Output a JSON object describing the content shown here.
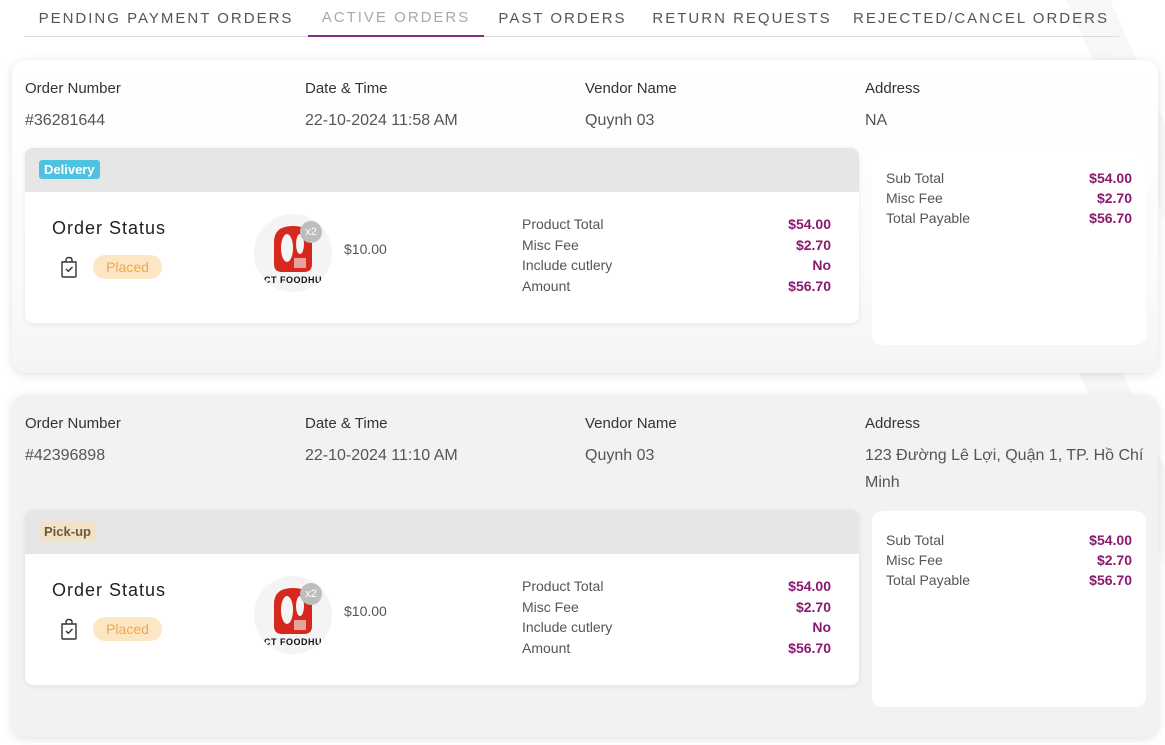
{
  "tabs": [
    {
      "label": "PENDING PAYMENT ORDERS"
    },
    {
      "label": "ACTIVE ORDERS"
    },
    {
      "label": "PAST ORDERS"
    },
    {
      "label": "RETURN REQUESTS"
    },
    {
      "label": "REJECTED/CANCEL ORDERS"
    }
  ],
  "labels": {
    "order_number": "Order Number",
    "date_time": "Date & Time",
    "vendor_name": "Vendor Name",
    "address": "Address",
    "order_status": "Order Status",
    "product_total": "Product Total",
    "misc_fee": "Misc Fee",
    "include_cutlery": "Include cutlery",
    "amount": "Amount",
    "sub_total": "Sub Total",
    "total_payable": "Total Payable"
  },
  "orders": [
    {
      "order_number": "#36281644",
      "date_time": "22-10-2024 11:58 AM",
      "vendor": "Quynh 03",
      "address": "NA",
      "type": "Delivery",
      "status": "Placed",
      "item_qty": "x2",
      "item_price": "$10.00",
      "item_logo_text": "CT FOODHU",
      "product_total": "$54.00",
      "misc_fee": "$2.70",
      "cutlery": "No",
      "amount": "$56.70",
      "sub_total": "$54.00",
      "total_payable": "$56.70"
    },
    {
      "order_number": "#42396898",
      "date_time": "22-10-2024 11:10 AM",
      "vendor": "Quynh 03",
      "address": "123 Đường Lê Lợi, Quận 1, TP. Hồ Chí Minh",
      "type": "Pick-up",
      "status": "Placed",
      "item_qty": "x2",
      "item_price": "$10.00",
      "item_logo_text": "CT FOODHU",
      "product_total": "$54.00",
      "misc_fee": "$2.70",
      "cutlery": "No",
      "amount": "$56.70",
      "sub_total": "$54.00",
      "total_payable": "$56.70"
    }
  ],
  "colors": {
    "accent": "#8a2a7e",
    "value_purple": "#8a1a6f",
    "delivery_badge": "#4ec3e0",
    "placed_bg": "#fde6c4",
    "placed_text": "#f0a650"
  },
  "icons": {
    "status": "shopping-bag-check-icon"
  }
}
